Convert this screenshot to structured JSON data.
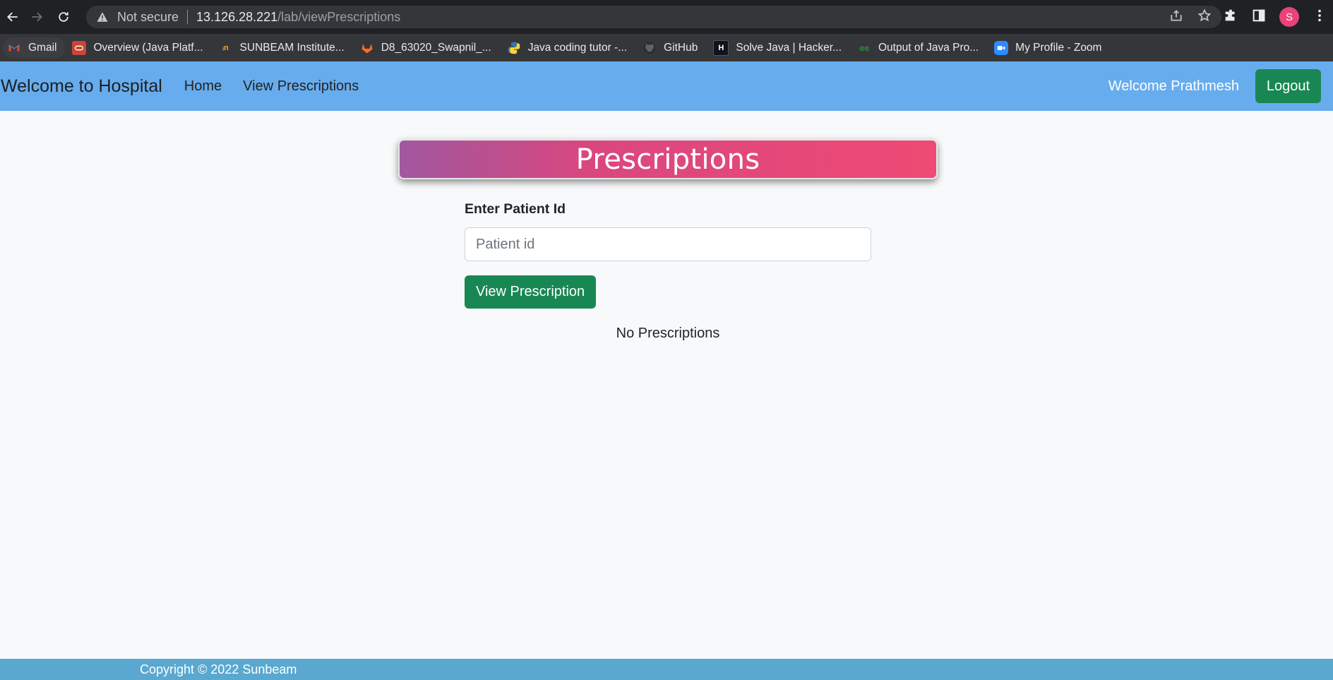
{
  "browser": {
    "not_secure": "Not secure",
    "url_host": "13.126.28.221",
    "url_path": "/lab/viewPrescriptions",
    "profile_initial": "S",
    "bookmarks": [
      {
        "label": "Gmail",
        "icon": "gmail-icon",
        "color": "#ea4335"
      },
      {
        "label": "Overview (Java Platf...",
        "icon": "oracle-icon",
        "color": "#c74634"
      },
      {
        "label": "SUNBEAM Institute...",
        "icon": "sunbeam-icon",
        "color": "#f5a623"
      },
      {
        "label": "D8_63020_Swapnil_...",
        "icon": "gitlab-icon",
        "color": "#fc6d26"
      },
      {
        "label": "Java coding tutor -...",
        "icon": "python-icon",
        "color": "#3776ab"
      },
      {
        "label": "GitHub",
        "icon": "github-icon",
        "color": "#ffffff"
      },
      {
        "label": "Solve Java | Hacker...",
        "icon": "hackerrank-icon",
        "color": "#1ba94c"
      },
      {
        "label": "Output of Java Pro...",
        "icon": "geeksforgeeks-icon",
        "color": "#2f8d46"
      },
      {
        "label": "My Profile - Zoom",
        "icon": "zoom-icon",
        "color": "#2d8cff"
      }
    ]
  },
  "navbar": {
    "brand": "Welcome to Hospital",
    "links": [
      "Home",
      "View Prescriptions"
    ],
    "welcome": "Welcome Prathmesh",
    "logout": "Logout",
    "bg_color": "#67aced"
  },
  "main": {
    "heading": "Prescriptions",
    "field_label": "Enter Patient Id",
    "input_placeholder": "Patient id",
    "input_value": "",
    "button": "View Prescription",
    "empty_message": "No Prescriptions"
  },
  "footer": {
    "text": "Copyright © 2022 Sunbeam"
  }
}
